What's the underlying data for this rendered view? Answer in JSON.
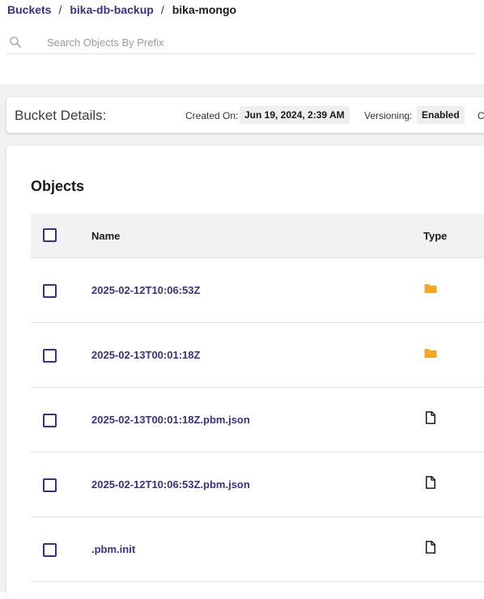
{
  "breadcrumb": {
    "items": [
      "Buckets",
      "bika-db-backup"
    ],
    "current": "bika-mongo",
    "separator": "/"
  },
  "search": {
    "placeholder": "Search Objects By Prefix",
    "value": ""
  },
  "details": {
    "title": "Bucket Details:",
    "created_label": "Created On:",
    "created_value": "Jun 19, 2024, 2:39 AM",
    "versioning_label": "Versioning:",
    "versioning_value": "Enabled",
    "trailing_text": "C"
  },
  "objects": {
    "title": "Objects",
    "columns": {
      "name": "Name",
      "type": "Type"
    },
    "rows": [
      {
        "name": "2025-02-12T10:06:53Z",
        "type_icon": "folder-icon"
      },
      {
        "name": "2025-02-13T00:01:18Z",
        "type_icon": "folder-icon"
      },
      {
        "name": "2025-02-13T00:01:18Z.pbm.json",
        "type_icon": "file-icon"
      },
      {
        "name": "2025-02-12T10:06:53Z.pbm.json",
        "type_icon": "file-icon"
      },
      {
        "name": ".pbm.init",
        "type_icon": "file-icon"
      }
    ]
  },
  "colors": {
    "accent": "#3a3086",
    "folder": "#f5a623",
    "background": "#f1f1f1"
  }
}
